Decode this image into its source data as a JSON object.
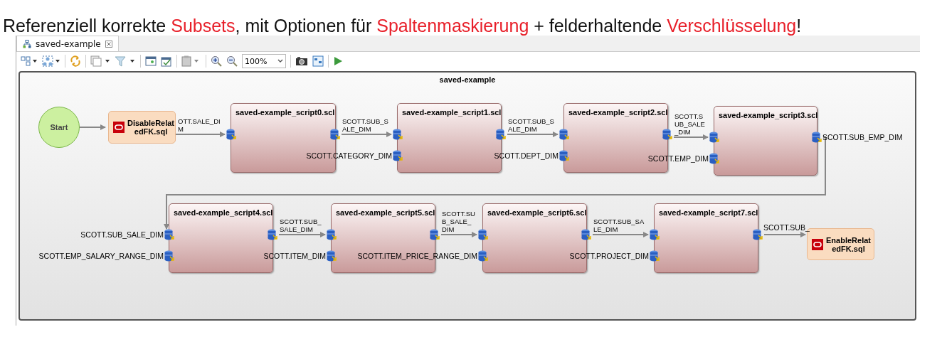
{
  "headline": [
    {
      "text": "Referenziell korrekte ",
      "highlight": false
    },
    {
      "text": "Subsets",
      "highlight": true
    },
    {
      "text": ", mit Optionen für ",
      "highlight": false
    },
    {
      "text": "Spaltenmaskierung",
      "highlight": true
    },
    {
      "text": " + felderhaltende ",
      "highlight": false
    },
    {
      "text": "Verschlüsselung",
      "highlight": true
    },
    {
      "text": "!",
      "highlight": false
    }
  ],
  "tab": {
    "title": "saved-example",
    "selected": true
  },
  "toolbar": {
    "zoom": "100%"
  },
  "diagram": {
    "title": "saved-example",
    "nodes": [
      {
        "kind": "start",
        "label": "Start"
      },
      {
        "kind": "sql",
        "label": "DisableRelat edFK.sql"
      },
      {
        "kind": "script",
        "label": "saved-example_script0.scl",
        "inputs": [
          "OTT.SALE_DIM"
        ]
      },
      {
        "kind": "script",
        "label": "saved-example_script1.scl",
        "inputs": [
          "SCOTT.SUB_SALE_DIM",
          "SCOTT.CATEGORY_DIM"
        ]
      },
      {
        "kind": "script",
        "label": "saved-example_script2.scl",
        "inputs": [
          "SCOTT.SUB_SALE_DIM",
          "SCOTT.DEPT_DIM"
        ]
      },
      {
        "kind": "script",
        "label": "saved-example_script3.scl",
        "inputs": [
          "SCOTT.SUB_SALE_DIM",
          "SCOTT.EMP_DIM"
        ],
        "outputs": [
          "SCOTT.SUB_EMP_DIM"
        ]
      },
      {
        "kind": "script",
        "label": "saved-example_script4.scl",
        "inputs": [
          "SCOTT.SUB_SALE_DIM",
          "SCOTT.EMP_SALARY_RANGE_DIM"
        ]
      },
      {
        "kind": "script",
        "label": "saved-example_script5.scl",
        "inputs": [
          "SCOTT.SUB_SALE_DIM",
          "SCOTT.ITEM_DIM"
        ]
      },
      {
        "kind": "script",
        "label": "saved-example_script6.scl",
        "inputs": [
          "SCOTT.SUB_SALE_DIM",
          "SCOTT.ITEM_PRICE_RANGE_DIM"
        ]
      },
      {
        "kind": "script",
        "label": "saved-example_script7.scl",
        "inputs": [
          "SCOTT.SUB_SALE_DIM",
          "SCOTT.PROJECT_DIM"
        ],
        "outputs": [
          "SCOTT.SUB_"
        ]
      },
      {
        "kind": "sql",
        "label": "EnableRelat edFK.sql"
      }
    ]
  }
}
